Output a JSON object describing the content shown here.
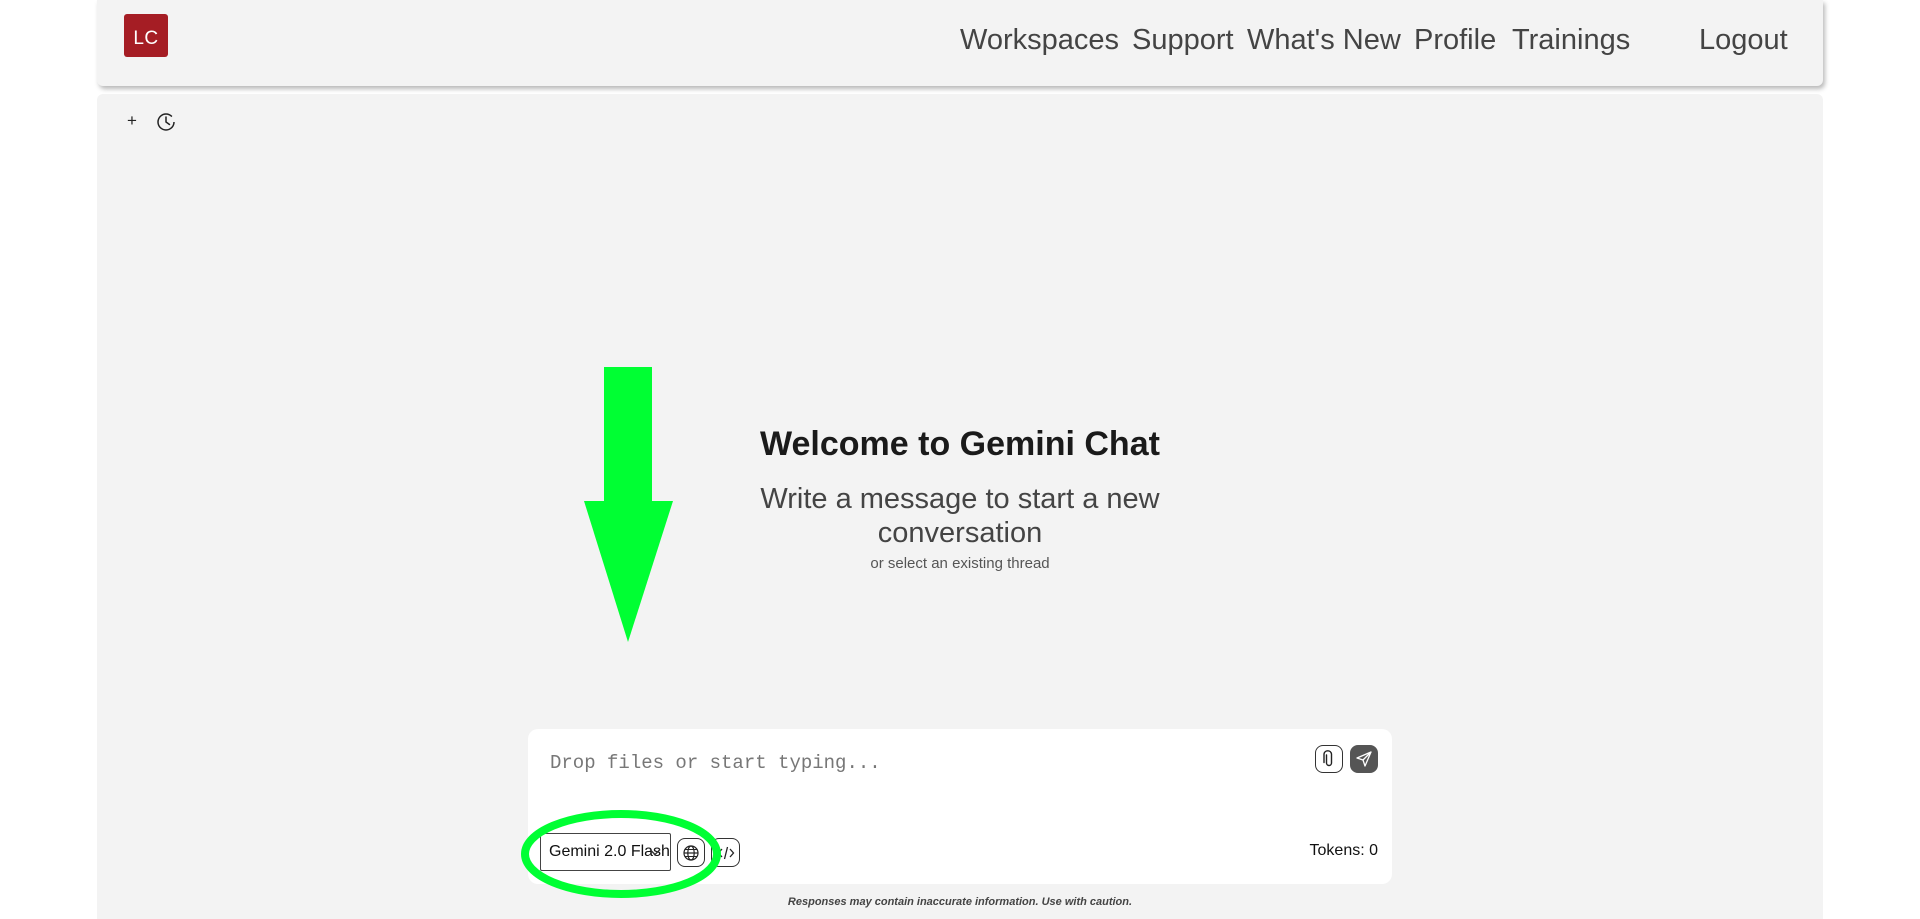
{
  "header": {
    "logo_text": "LC",
    "logo_color": "#a51d24",
    "nav": {
      "workspaces": "Workspaces",
      "support": "Support",
      "whats_new": "What's New",
      "profile": "Profile",
      "trainings": "Trainings",
      "logout": "Logout"
    }
  },
  "toolbar": {
    "new_chat_icon": "plus-icon",
    "history_icon": "clock-history-icon",
    "new_chat_glyph": "+"
  },
  "welcome": {
    "title": "Welcome to Gemini Chat",
    "subtitle": "Write a message to start a new conversation",
    "hint": "or select an existing thread"
  },
  "composer": {
    "placeholder": "Drop files or start typing...",
    "value": "",
    "attach_icon": "paperclip-icon",
    "send_icon": "send-icon",
    "model_selected": "Gemini 2.0 Flash",
    "web_icon": "globe-icon",
    "code_icon": "code-icon",
    "tokens_label": "Tokens: 0"
  },
  "disclaimer": "Responses may contain inaccurate information. Use with caution.",
  "annotations": {
    "arrow_color": "#00ff33",
    "circle_color": "#00ff33"
  }
}
